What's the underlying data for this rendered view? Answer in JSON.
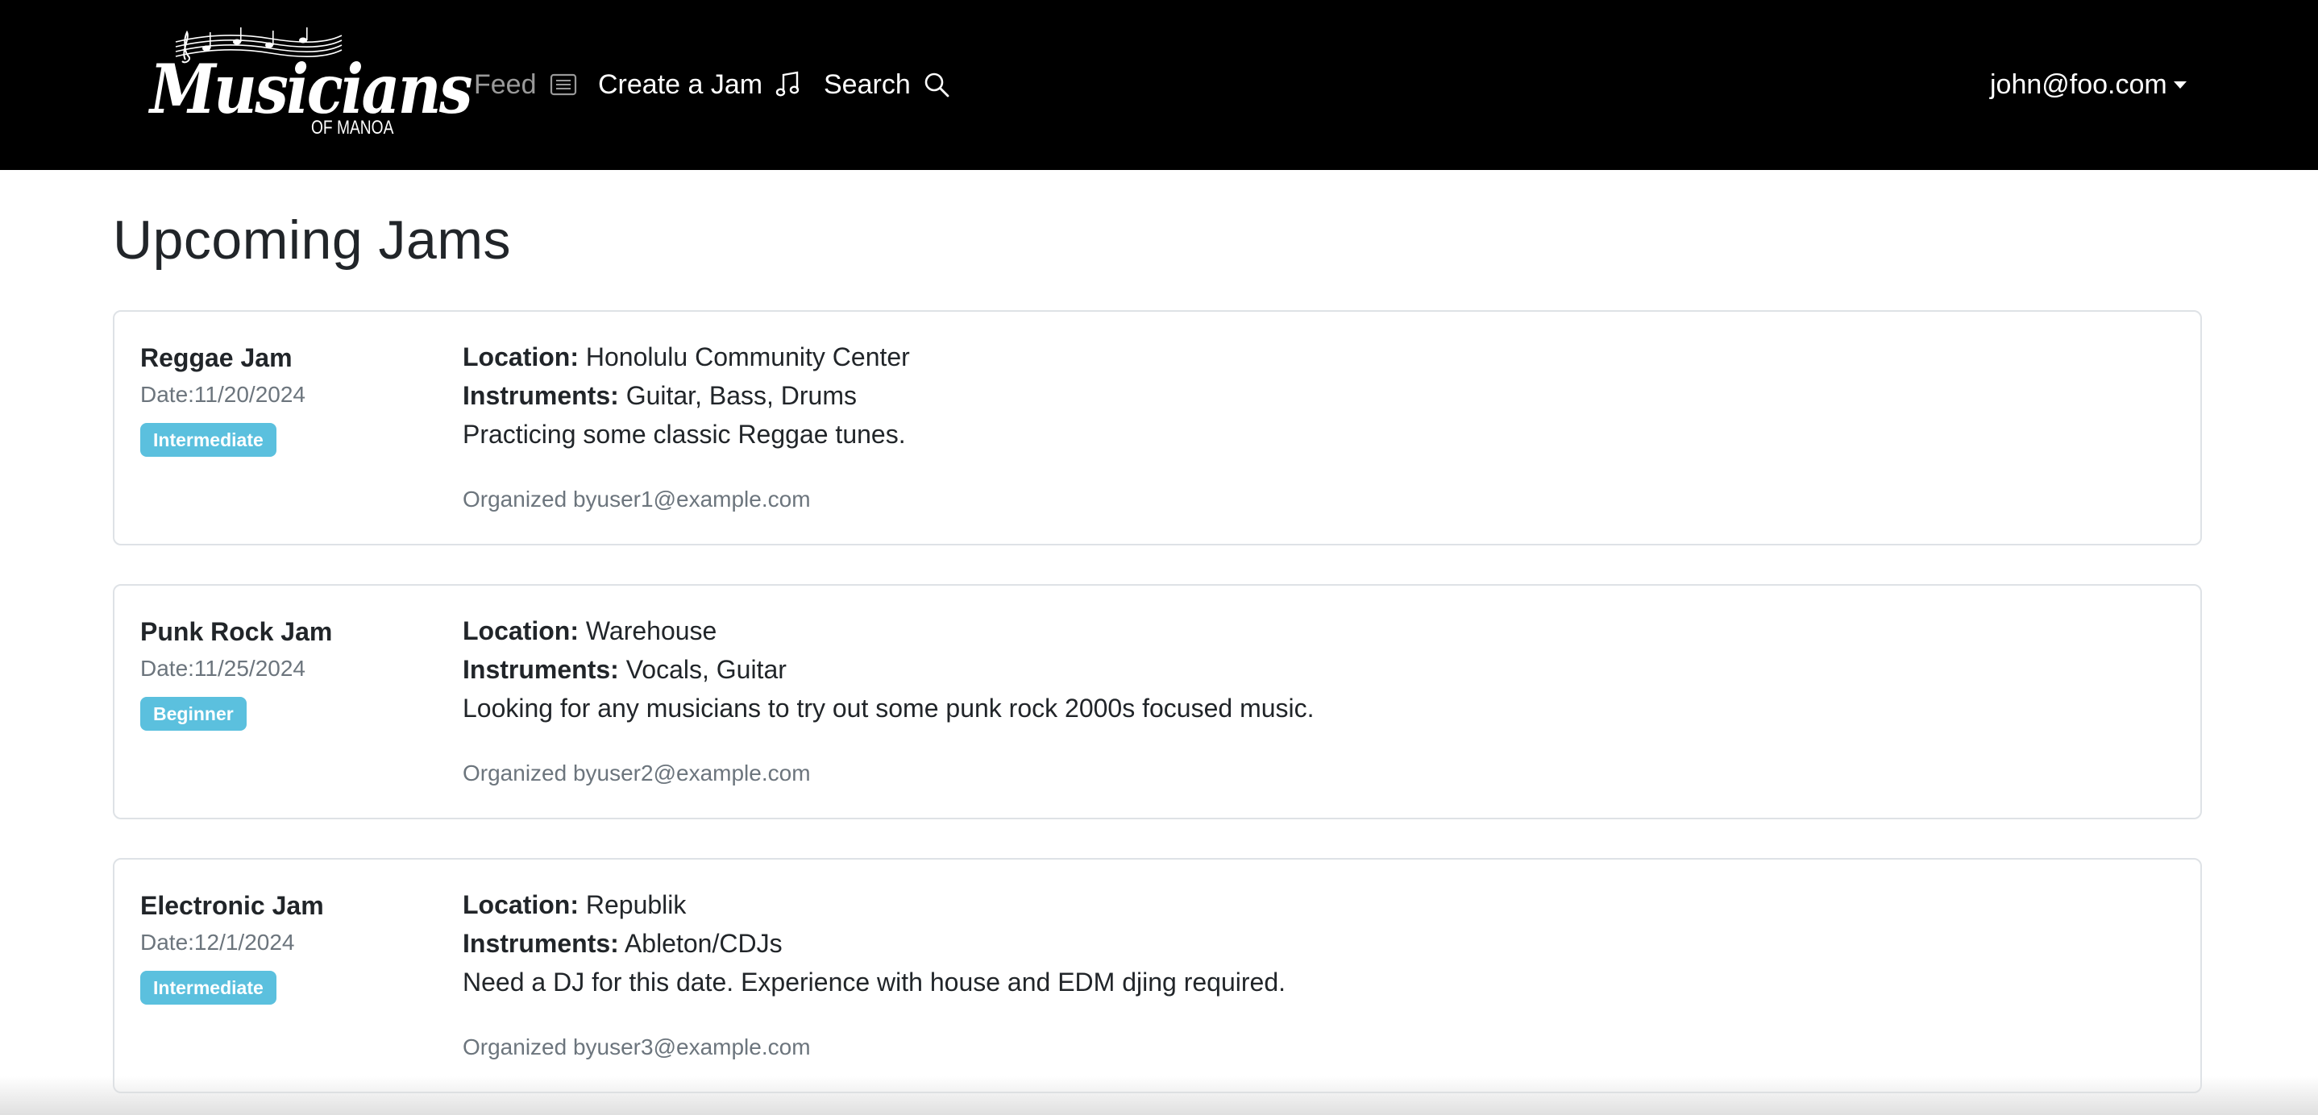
{
  "navbar": {
    "logo": {
      "word": "Musicians",
      "sub": "OF MANOA"
    },
    "links": {
      "feed": {
        "label": "Feed",
        "icon": "list-icon"
      },
      "create": {
        "label": "Create a Jam",
        "icon": "music-note-icon"
      },
      "search": {
        "label": "Search",
        "icon": "search-icon"
      }
    },
    "user": {
      "email": "john@foo.com"
    },
    "colors": {
      "background": "#000000",
      "text": "#ffffff"
    }
  },
  "page": {
    "title": "Upcoming Jams"
  },
  "labels": {
    "location": "Location:",
    "instruments": "Instruments:"
  },
  "jams": [
    {
      "name": "Reggae Jam",
      "date": "Date:11/20/2024",
      "level": "Intermediate",
      "location": "Honolulu Community Center",
      "instruments": "Guitar, Bass, Drums",
      "description": "Practicing some classic Reggae tunes.",
      "organizer": "Organized byuser1@example.com"
    },
    {
      "name": "Punk Rock Jam",
      "date": "Date:11/25/2024",
      "level": "Beginner",
      "location": "Warehouse",
      "instruments": "Vocals, Guitar",
      "description": "Looking for any musicians to try out some punk rock 2000s focused music.",
      "organizer": "Organized byuser2@example.com"
    },
    {
      "name": "Electronic Jam",
      "date": "Date:12/1/2024",
      "level": "Intermediate",
      "location": "Republik",
      "instruments": "Ableton/CDJs",
      "description": "Need a DJ for this date. Experience with house and EDM djing required.",
      "organizer": "Organized byuser3@example.com"
    }
  ],
  "colors": {
    "badge": "#5bc0de",
    "muted": "#6c757d",
    "border": "#dee2e6"
  }
}
